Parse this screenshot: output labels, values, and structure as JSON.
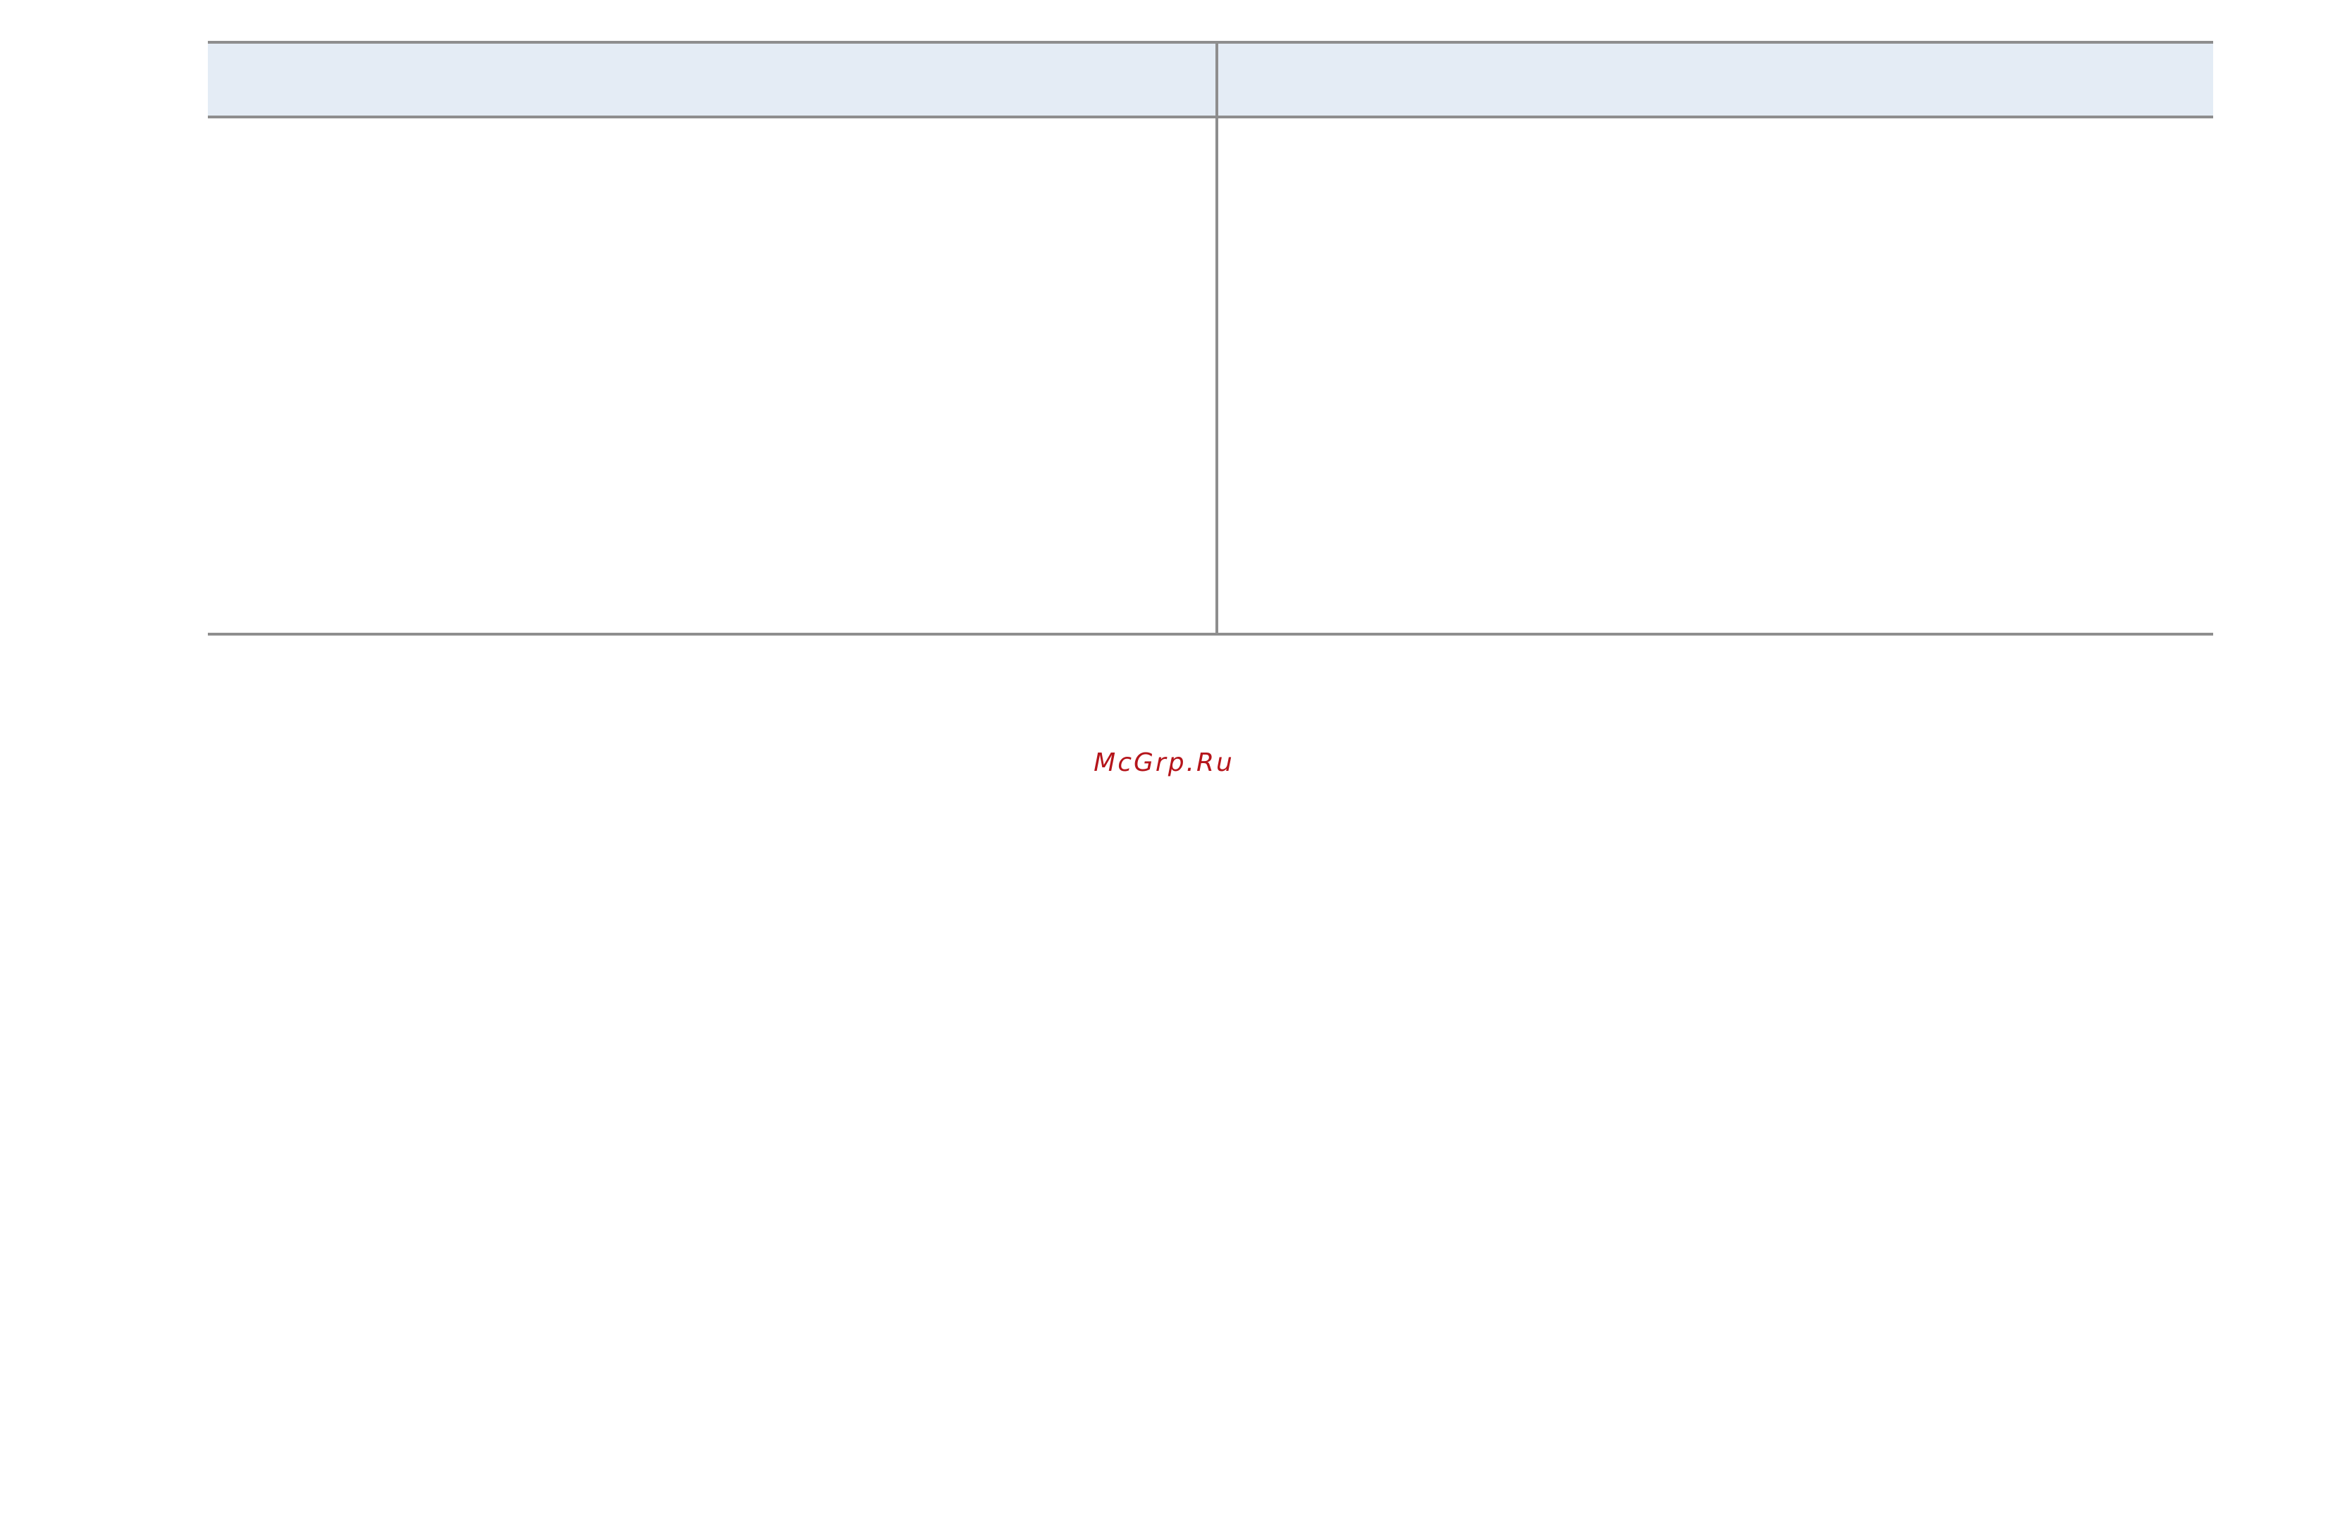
{
  "table": {
    "header": [
      "",
      ""
    ],
    "body": [
      "",
      ""
    ]
  },
  "watermark": {
    "text": "McGrp.Ru",
    "color": "#b5151b"
  },
  "colors": {
    "header_background": "#e4ecf5",
    "rule": "#8e8e8e",
    "page": "#ffffff"
  }
}
